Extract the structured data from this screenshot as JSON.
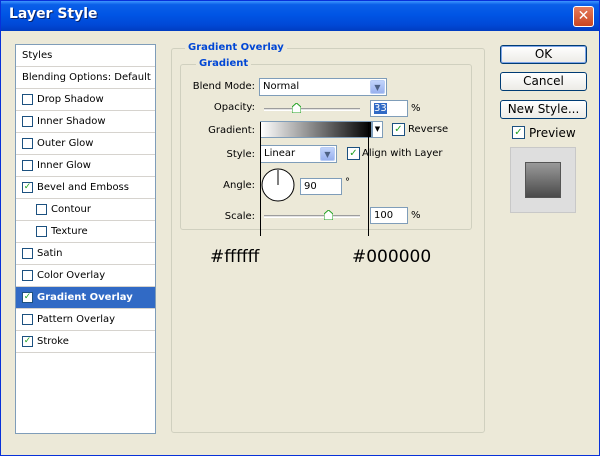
{
  "window": {
    "title": "Layer Style",
    "close_glyph": "✕"
  },
  "styles_list": {
    "header": "Styles",
    "blending": "Blending Options: Default",
    "items": [
      {
        "label": "Drop Shadow",
        "checked": false,
        "indent": false,
        "selected": false
      },
      {
        "label": "Inner Shadow",
        "checked": false,
        "indent": false,
        "selected": false
      },
      {
        "label": "Outer Glow",
        "checked": false,
        "indent": false,
        "selected": false
      },
      {
        "label": "Inner Glow",
        "checked": false,
        "indent": false,
        "selected": false
      },
      {
        "label": "Bevel and Emboss",
        "checked": true,
        "indent": false,
        "selected": false
      },
      {
        "label": "Contour",
        "checked": false,
        "indent": true,
        "selected": false
      },
      {
        "label": "Texture",
        "checked": false,
        "indent": true,
        "selected": false
      },
      {
        "label": "Satin",
        "checked": false,
        "indent": false,
        "selected": false
      },
      {
        "label": "Color Overlay",
        "checked": false,
        "indent": false,
        "selected": false
      },
      {
        "label": "Gradient Overlay",
        "checked": true,
        "indent": false,
        "selected": true
      },
      {
        "label": "Pattern Overlay",
        "checked": false,
        "indent": false,
        "selected": false
      },
      {
        "label": "Stroke",
        "checked": true,
        "indent": false,
        "selected": false
      }
    ]
  },
  "panel": {
    "outer_title": "Gradient Overlay",
    "inner_title": "Gradient",
    "blend_mode": {
      "label": "Blend Mode:",
      "value": "Normal"
    },
    "opacity": {
      "label": "Opacity:",
      "value": "33",
      "unit": "%",
      "level": 0.33
    },
    "gradient": {
      "label": "Gradient:",
      "reverse_label": "Reverse",
      "reverse_checked": true,
      "from_color": "#ffffff",
      "to_color": "#000000"
    },
    "style": {
      "label": "Style:",
      "value": "Linear",
      "align_label": "Align with Layer",
      "align_checked": true
    },
    "angle": {
      "label": "Angle:",
      "value": "90",
      "unit": "°"
    },
    "scale": {
      "label": "Scale:",
      "value": "100",
      "unit": "%",
      "level": 0.67
    }
  },
  "buttons": {
    "ok": "OK",
    "cancel": "Cancel",
    "new_style": "New Style..."
  },
  "preview": {
    "label": "Preview",
    "checked": true
  },
  "annotations": {
    "left": "#ffffff",
    "right": "#000000"
  },
  "colors": {
    "title_bar": "#0055e5",
    "selection": "#316ac5",
    "group_title": "#0046d5"
  }
}
